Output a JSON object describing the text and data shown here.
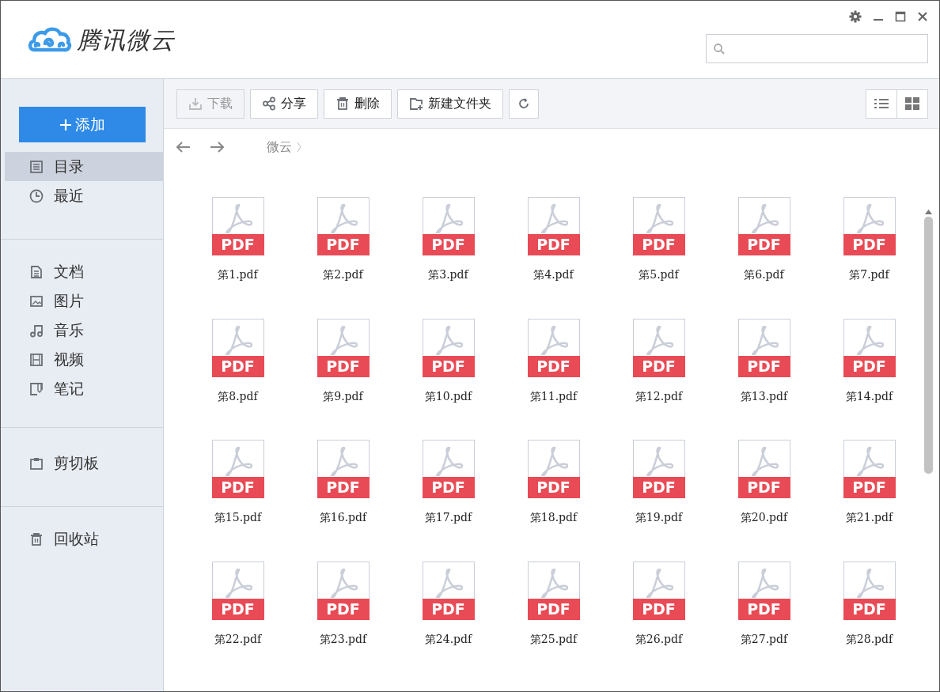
{
  "app": {
    "name": "腾讯微云"
  },
  "add_button": {
    "label": "添加"
  },
  "sidebar": {
    "groups": [
      {
        "items": [
          {
            "label": "目录",
            "kind": "list",
            "selected": true
          },
          {
            "label": "最近",
            "kind": "clock",
            "selected": false
          }
        ]
      },
      {
        "items": [
          {
            "label": "文档",
            "kind": "doc",
            "selected": false
          },
          {
            "label": "图片",
            "kind": "image",
            "selected": false
          },
          {
            "label": "音乐",
            "kind": "music",
            "selected": false
          },
          {
            "label": "视频",
            "kind": "film",
            "selected": false
          },
          {
            "label": "笔记",
            "kind": "note",
            "selected": false
          }
        ]
      },
      {
        "items": [
          {
            "label": "剪切板",
            "kind": "clipboard",
            "selected": false
          }
        ]
      },
      {
        "items": [
          {
            "label": "回收站",
            "kind": "trash",
            "selected": false
          }
        ]
      }
    ]
  },
  "toolbar": [
    {
      "label": "下载",
      "kind": "download",
      "disabled": true
    },
    {
      "label": "分享",
      "kind": "share",
      "disabled": false
    },
    {
      "label": "删除",
      "kind": "trash",
      "disabled": false
    },
    {
      "label": "新建文件夹",
      "kind": "folder",
      "disabled": false
    },
    {
      "kind": "refresh",
      "disabled": false
    }
  ],
  "breadcrumb": [
    {
      "label": "微云"
    }
  ],
  "files": [
    {
      "name": "第1.pdf",
      "badge": "PDF"
    },
    {
      "name": "第2.pdf",
      "badge": "PDF"
    },
    {
      "name": "第3.pdf",
      "badge": "PDF"
    },
    {
      "name": "第4.pdf",
      "badge": "PDF"
    },
    {
      "name": "第5.pdf",
      "badge": "PDF"
    },
    {
      "name": "第6.pdf",
      "badge": "PDF"
    },
    {
      "name": "第7.pdf",
      "badge": "PDF"
    },
    {
      "name": "第8.pdf",
      "badge": "PDF"
    },
    {
      "name": "第9.pdf",
      "badge": "PDF"
    },
    {
      "name": "第10.pdf",
      "badge": "PDF"
    },
    {
      "name": "第11.pdf",
      "badge": "PDF"
    },
    {
      "name": "第12.pdf",
      "badge": "PDF"
    },
    {
      "name": "第13.pdf",
      "badge": "PDF"
    },
    {
      "name": "第14.pdf",
      "badge": "PDF"
    },
    {
      "name": "第15.pdf",
      "badge": "PDF"
    },
    {
      "name": "第16.pdf",
      "badge": "PDF"
    },
    {
      "name": "第17.pdf",
      "badge": "PDF"
    },
    {
      "name": "第18.pdf",
      "badge": "PDF"
    },
    {
      "name": "第19.pdf",
      "badge": "PDF"
    },
    {
      "name": "第20.pdf",
      "badge": "PDF"
    },
    {
      "name": "第21.pdf",
      "badge": "PDF"
    },
    {
      "name": "第22.pdf",
      "badge": "PDF"
    },
    {
      "name": "第23.pdf",
      "badge": "PDF"
    },
    {
      "name": "第24.pdf",
      "badge": "PDF"
    },
    {
      "name": "第25.pdf",
      "badge": "PDF"
    },
    {
      "name": "第26.pdf",
      "badge": "PDF"
    },
    {
      "name": "第27.pdf",
      "badge": "PDF"
    },
    {
      "name": "第28.pdf",
      "badge": "PDF"
    }
  ]
}
